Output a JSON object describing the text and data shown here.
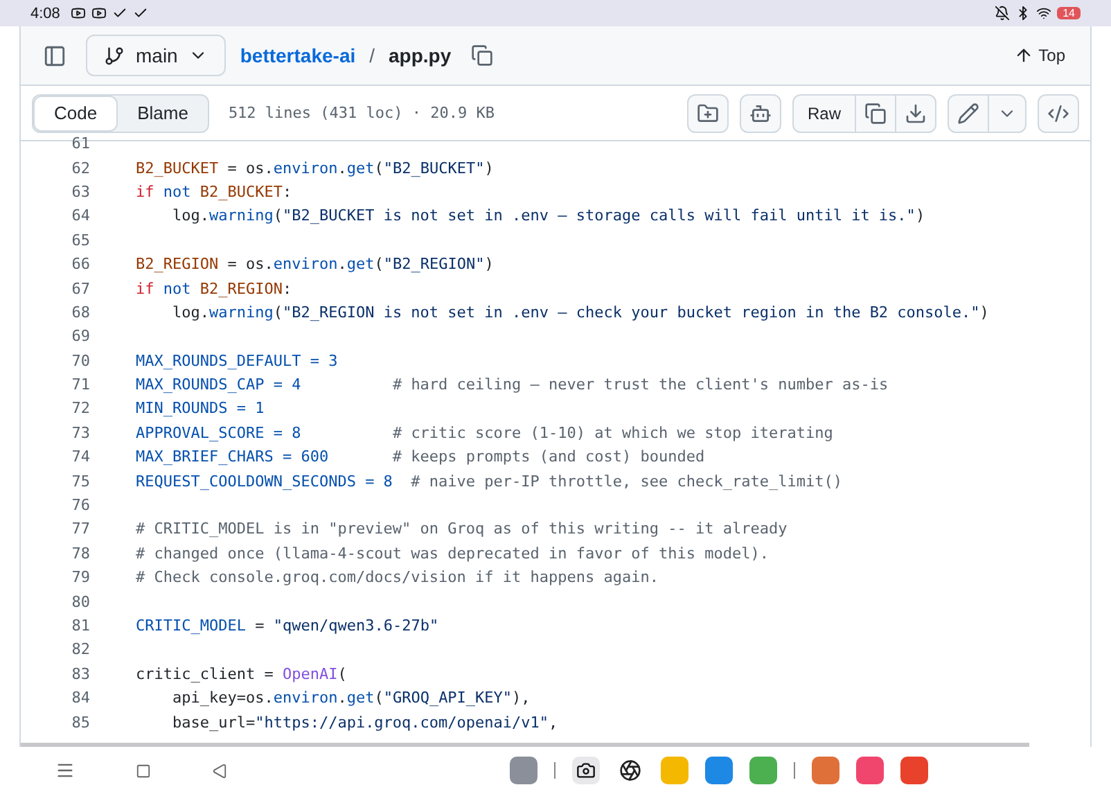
{
  "status_bar": {
    "time": "4:08",
    "battery": "14"
  },
  "header": {
    "branch": "main",
    "repo": "bettertake-ai",
    "separator": "/",
    "file": "app.py",
    "top_label": "Top"
  },
  "toolbar": {
    "tabs": [
      {
        "label": "Code",
        "selected": true
      },
      {
        "label": "Blame",
        "selected": false
      }
    ],
    "file_info": "512 lines (431 loc) · 20.9 KB",
    "raw_label": "Raw"
  },
  "code_lines": [
    {
      "number": "61"
    },
    {
      "number": "62",
      "tokens": [
        {
          "kind": "var",
          "text": "B2_BUCKET"
        },
        {
          "kind": "plain",
          "text": " = os."
        },
        {
          "kind": "fn",
          "text": "environ"
        },
        {
          "kind": "plain",
          "text": "."
        },
        {
          "kind": "fn",
          "text": "get"
        },
        {
          "kind": "plain",
          "text": "("
        },
        {
          "kind": "str",
          "text": "\"B2_BUCKET\""
        },
        {
          "kind": "plain",
          "text": ")"
        }
      ]
    },
    {
      "number": "63",
      "tokens": [
        {
          "kind": "kw",
          "text": "if"
        },
        {
          "kind": "fn",
          "text": " not"
        },
        {
          "kind": "var",
          "text": " B2_BUCKET"
        },
        {
          "kind": "plain",
          "text": ":"
        }
      ]
    },
    {
      "number": "64",
      "tokens": [
        {
          "kind": "plain",
          "text": "    log."
        },
        {
          "kind": "fn",
          "text": "warning"
        },
        {
          "kind": "plain",
          "text": "("
        },
        {
          "kind": "str",
          "text": "\"B2_BUCKET is not set in .env — storage calls will fail until it is.\""
        },
        {
          "kind": "plain",
          "text": ")"
        }
      ]
    },
    {
      "number": "65"
    },
    {
      "number": "66",
      "tokens": [
        {
          "kind": "var",
          "text": "B2_REGION"
        },
        {
          "kind": "plain",
          "text": " = os."
        },
        {
          "kind": "fn",
          "text": "environ"
        },
        {
          "kind": "plain",
          "text": "."
        },
        {
          "kind": "fn",
          "text": "get"
        },
        {
          "kind": "plain",
          "text": "("
        },
        {
          "kind": "str",
          "text": "\"B2_REGION\""
        },
        {
          "kind": "plain",
          "text": ")"
        }
      ]
    },
    {
      "number": "67",
      "tokens": [
        {
          "kind": "kw",
          "text": "if"
        },
        {
          "kind": "fn",
          "text": " not"
        },
        {
          "kind": "var",
          "text": " B2_REGION"
        },
        {
          "kind": "plain",
          "text": ":"
        }
      ]
    },
    {
      "number": "68",
      "tokens": [
        {
          "kind": "plain",
          "text": "    log."
        },
        {
          "kind": "fn",
          "text": "warning"
        },
        {
          "kind": "plain",
          "text": "("
        },
        {
          "kind": "str",
          "text": "\"B2_REGION is not set in .env — check your bucket region in the B2 console.\""
        },
        {
          "kind": "plain",
          "text": ")"
        }
      ]
    },
    {
      "number": "69"
    },
    {
      "number": "70",
      "tokens": [
        {
          "kind": "const",
          "text": "MAX_ROUNDS_DEFAULT = 3"
        }
      ]
    },
    {
      "number": "71",
      "tokens": [
        {
          "kind": "const",
          "text": "MAX_ROUNDS_CAP = 4"
        },
        {
          "kind": "com",
          "text": "          # hard ceiling — never trust the client's number as-is"
        }
      ]
    },
    {
      "number": "72",
      "tokens": [
        {
          "kind": "const",
          "text": "MIN_ROUNDS = 1"
        }
      ]
    },
    {
      "number": "73",
      "tokens": [
        {
          "kind": "const",
          "text": "APPROVAL_SCORE = 8"
        },
        {
          "kind": "com",
          "text": "          # critic score (1-10) at which we stop iterating"
        }
      ]
    },
    {
      "number": "74",
      "tokens": [
        {
          "kind": "const",
          "text": "MAX_BRIEF_CHARS = 600"
        },
        {
          "kind": "com",
          "text": "       # keeps prompts (and cost) bounded"
        }
      ]
    },
    {
      "number": "75",
      "tokens": [
        {
          "kind": "const",
          "text": "REQUEST_COOLDOWN_SECONDS = 8"
        },
        {
          "kind": "com",
          "text": "  # naive per-IP throttle, see check_rate_limit()"
        }
      ]
    },
    {
      "number": "76"
    },
    {
      "number": "77",
      "tokens": [
        {
          "kind": "com",
          "text": "# CRITIC_MODEL is in \"preview\" on Groq as of this writing -- it already"
        }
      ]
    },
    {
      "number": "78",
      "tokens": [
        {
          "kind": "com",
          "text": "# changed once (llama-4-scout was deprecated in favor of this model)."
        }
      ]
    },
    {
      "number": "79",
      "tokens": [
        {
          "kind": "com",
          "text": "# Check console.groq.com/docs/vision if it happens again."
        }
      ]
    },
    {
      "number": "80"
    },
    {
      "number": "81",
      "tokens": [
        {
          "kind": "const",
          "text": "CRITIC_MODEL"
        },
        {
          "kind": "plain",
          "text": " = "
        },
        {
          "kind": "str",
          "text": "\"qwen/qwen3.6-27b\""
        }
      ]
    },
    {
      "number": "82"
    },
    {
      "number": "83",
      "tokens": [
        {
          "kind": "plain",
          "text": "critic_client = "
        },
        {
          "kind": "cls",
          "text": "OpenAI"
        },
        {
          "kind": "plain",
          "text": "("
        }
      ]
    },
    {
      "number": "84",
      "tokens": [
        {
          "kind": "plain",
          "text": "    api_key=os."
        },
        {
          "kind": "fn",
          "text": "environ"
        },
        {
          "kind": "plain",
          "text": "."
        },
        {
          "kind": "fn",
          "text": "get"
        },
        {
          "kind": "plain",
          "text": "("
        },
        {
          "kind": "str",
          "text": "\"GROQ_API_KEY\""
        },
        {
          "kind": "plain",
          "text": "),"
        }
      ]
    },
    {
      "number": "85",
      "tokens": [
        {
          "kind": "plain",
          "text": "    base_url="
        },
        {
          "kind": "str",
          "text": "\"https://api.groq.com/openai/v1\""
        },
        {
          "kind": "plain",
          "text": ","
        }
      ]
    }
  ]
}
